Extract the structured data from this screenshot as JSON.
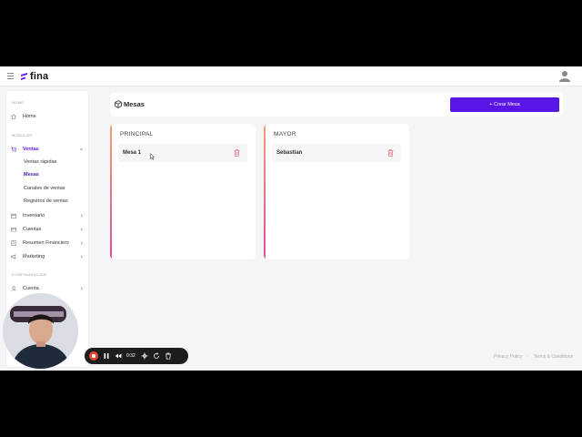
{
  "app": {
    "name": "fina",
    "accent": "#5b14e6",
    "active_color": "#6b21e8"
  },
  "sidebar": {
    "sections": {
      "home": "HOME",
      "modules": "MODULOS",
      "config": "CONFIGURACIÓN"
    },
    "home_item": {
      "label": "Home",
      "icon": "home-icon"
    },
    "items": [
      {
        "label": "Ventas",
        "icon": "cart-icon",
        "active": true,
        "expanded": true
      },
      {
        "label": "Inventario",
        "icon": "box-icon"
      },
      {
        "label": "Cuentas",
        "icon": "card-icon"
      },
      {
        "label": "Resumen Financiero",
        "icon": "report-icon"
      },
      {
        "label": "Marketing",
        "icon": "megaphone-icon"
      }
    ],
    "sub_items": [
      {
        "label": "Ventas rápidas"
      },
      {
        "label": "Mesas",
        "active": true
      },
      {
        "label": "Canales de ventas"
      },
      {
        "label": "Registros de ventas"
      }
    ],
    "config_items": [
      {
        "label": "Cuenta",
        "icon": "user-icon"
      }
    ]
  },
  "header": {
    "title": "Mesas",
    "create_button": "+ Crear Mesa"
  },
  "areas": [
    {
      "title": "PRINCIPAL",
      "tables": [
        "Mesa 1"
      ]
    },
    {
      "title": "MAYOR",
      "tables": [
        "Sebastian"
      ]
    }
  ],
  "footer": {
    "privacy": "Privacy Policy",
    "sep": "·",
    "terms": "Terms & Conditions"
  },
  "recorder": {
    "time": "0:32"
  }
}
